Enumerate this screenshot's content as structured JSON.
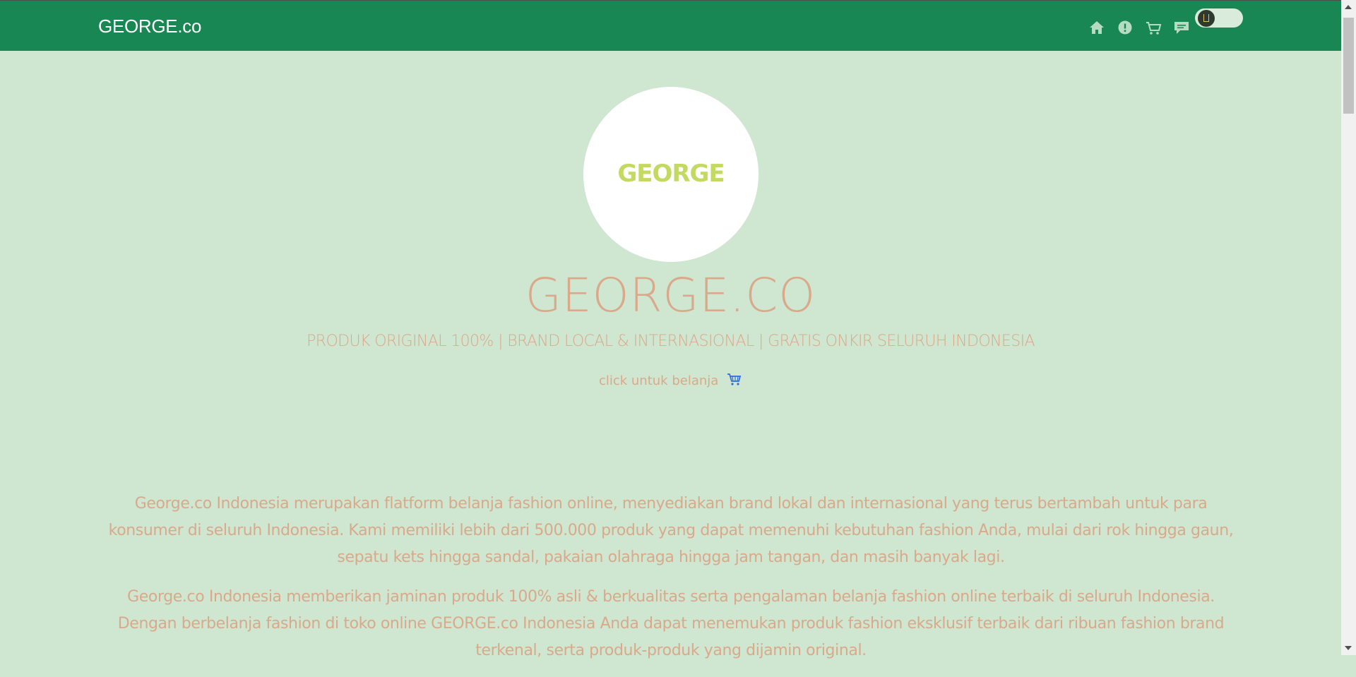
{
  "navbar": {
    "brand": "GEORGE.co",
    "icons": [
      "home-icon",
      "info-icon",
      "cart-icon",
      "chat-icon"
    ],
    "theme_toggle": "dark-mode-toggle"
  },
  "hero": {
    "logo_text": "GEORGE",
    "title": "GEORGE.CO",
    "subtitle": "PRODUK ORIGINAL 100% | BRAND LOCAL & INTERNASIONAL | GRATIS ONKIR SELURUH INDONESIA",
    "cta": "click untuk belanja"
  },
  "about": {
    "paragraphs": [
      "George.co Indonesia merupakan flatform belanja fashion online, menyediakan brand lokal dan internasional yang terus bertambah untuk para konsumer di seluruh Indonesia. Kami memiliki lebih dari 500.000 produk yang dapat memenuhi kebutuhan fashion Anda, mulai dari rok hingga gaun, sepatu kets hingga sandal, pakaian olahraga hingga jam tangan, dan masih banyak lagi.",
      "George.co Indonesia memberikan jaminan produk 100% asli & berkualitas serta pengalaman belanja fashion online terbaik di seluruh Indonesia. Dengan berbelanja fashion di toko online GEORGE.co Indonesia Anda dapat menemukan produk fashion eksklusif terbaik dari ribuan fashion brand terkenal, serta produk-produk yang dijamin original."
    ]
  },
  "colors": {
    "navbar": "#198754",
    "background": "#cfe6d1",
    "text_accent": "#d9a98a",
    "logo": "#c3d962"
  }
}
